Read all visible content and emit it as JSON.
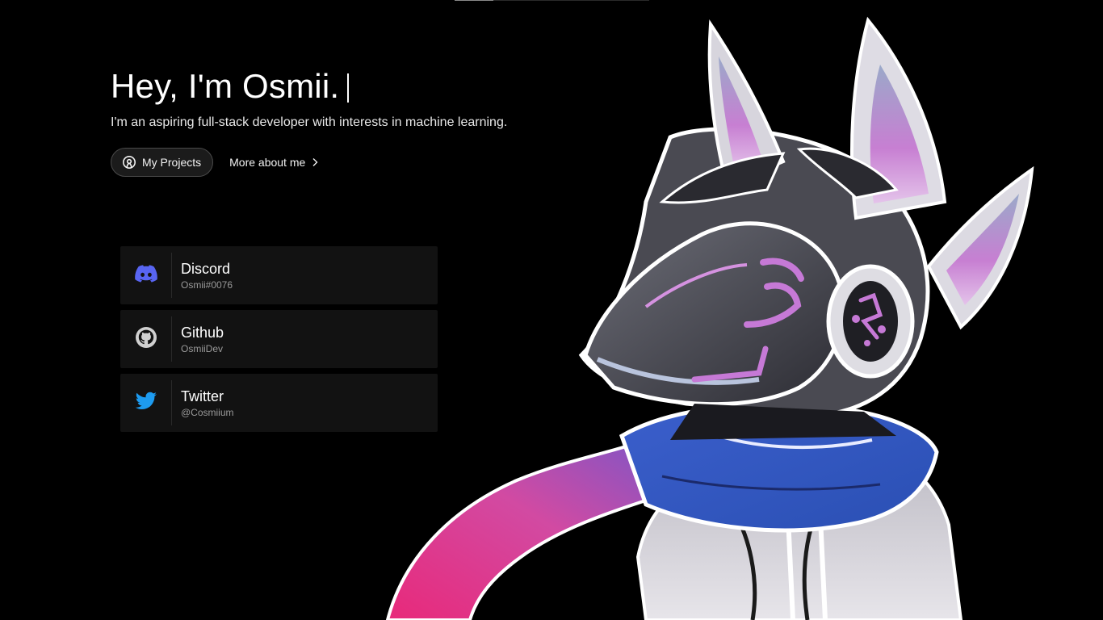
{
  "hero": {
    "title": "Hey, I'm Osmii.",
    "subtitle": "I'm an aspiring full-stack developer with interests in machine learning."
  },
  "actions": {
    "projects_label": "My Projects",
    "more_label": "More about me"
  },
  "socials": [
    {
      "name": "Discord",
      "handle": "Osmii#0076",
      "icon": "discord-icon",
      "color": "#5865f2"
    },
    {
      "name": "Github",
      "handle": "OsmiiDev",
      "icon": "github-icon",
      "color": "#d0d0d0"
    },
    {
      "name": "Twitter",
      "handle": "@Cosmiium",
      "icon": "twitter-icon",
      "color": "#1d9bf0"
    }
  ],
  "colors": {
    "background": "#000000",
    "card": "#121212",
    "accent_pink": "#e8297a",
    "accent_blue": "#2f5fc4",
    "accent_purple": "#c679d6"
  }
}
